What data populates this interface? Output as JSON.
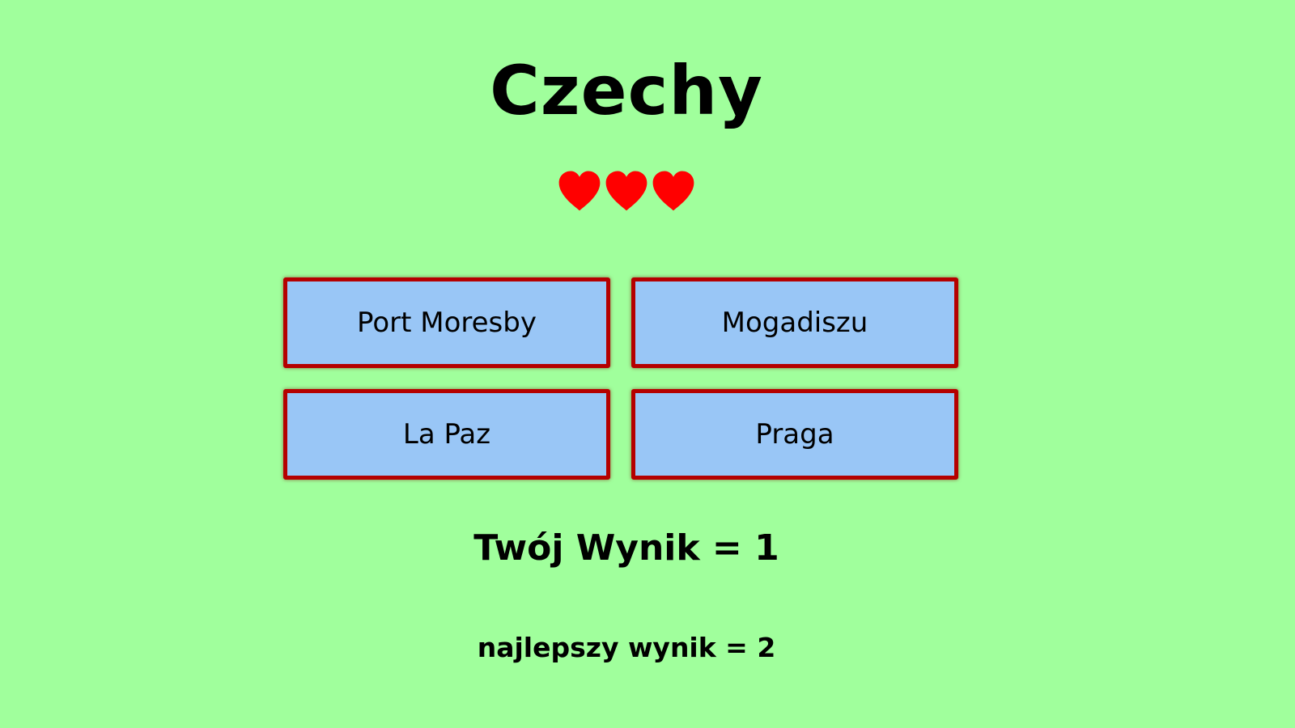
{
  "game": {
    "question": "Czechy",
    "lives": 3,
    "life_color": "#ff0000",
    "answers": [
      {
        "label": "Port Moresby"
      },
      {
        "label": "Mogadiszu"
      },
      {
        "label": "La Paz"
      },
      {
        "label": "Praga"
      }
    ],
    "score_text": "Twój Wynik = 1",
    "best_score_text": "najlepszy wynik = 2"
  },
  "colors": {
    "background": "#a0ff9c",
    "button_fill": "#99c6f6",
    "button_border": "#b50000"
  }
}
